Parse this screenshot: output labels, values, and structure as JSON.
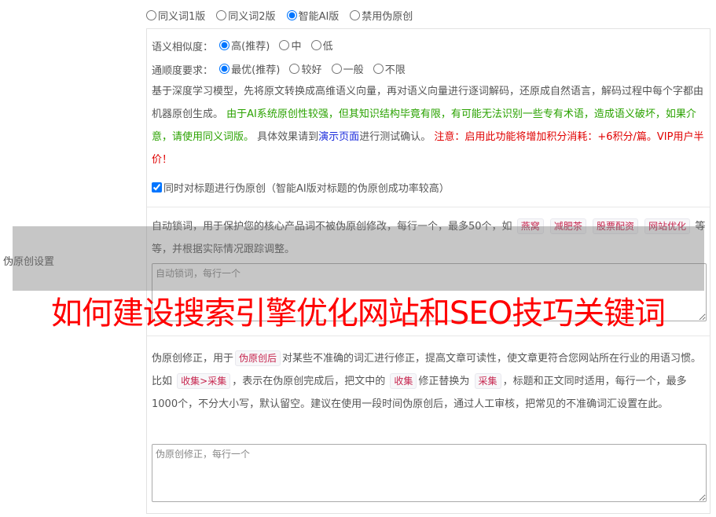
{
  "version_options": [
    {
      "label": "同义词1版",
      "checked": false
    },
    {
      "label": "同义词2版",
      "checked": false
    },
    {
      "label": "智能AI版",
      "checked": true
    },
    {
      "label": "禁用伪原创",
      "checked": false
    }
  ],
  "similarity": {
    "label": "语义相似度：",
    "options": [
      {
        "label": "高(推荐)",
        "checked": true
      },
      {
        "label": "中",
        "checked": false
      },
      {
        "label": "低",
        "checked": false
      }
    ]
  },
  "fluency": {
    "label": "通顺度要求：",
    "options": [
      {
        "label": "最优(推荐)",
        "checked": true
      },
      {
        "label": "较好",
        "checked": false
      },
      {
        "label": "一般",
        "checked": false
      },
      {
        "label": "不限",
        "checked": false
      }
    ]
  },
  "ai_desc": {
    "part1": "基于深度学习模型，先将原文转换成高维语义向量，再对语义向量进行逐词解码，还原成自然语言，解码过程中每个字都由机器原创生成。",
    "green": "由于AI系统原创性较强，但其知识结构毕竟有限，有可能无法识别一些专有术语，造成语义破坏，如果介意，请使用同义词版。",
    "part2": "具体效果请到",
    "link": "演示页面",
    "part3": "进行测试确认。",
    "red": "注意：启用此功能将增加积分消耗：+6积分/篇。VIP用户半价！"
  },
  "title_checkbox": {
    "label": "同时对标题进行伪原创（智能AI版对标题的伪原创成功率较高）",
    "checked": true
  },
  "lock": {
    "desc1": "自动锁词，用于保护您的核心产品词不被伪原创修改，每行一个，最多50个，如",
    "examples": [
      "燕窝",
      "减肥茶",
      "股票配资",
      "网站优化"
    ],
    "desc2": "等等，并根据实际情况跟踪调整。",
    "placeholder": "自动锁词，每行一个"
  },
  "correction": {
    "desc1": "伪原创修正，用于",
    "tag1": "伪原创后",
    "desc2": "对某些不准确的词汇进行修正，提高文章可读性，使文章更符合您网站所在行业的用语习惯。比如",
    "tag2": "收集>采集",
    "desc3": "，表示在伪原创完成后，把文中的",
    "tag3": "收集",
    "desc4": "修正替换为",
    "tag4": "采集",
    "desc5": "，标题和正文同时适用，每行一个，最多1000个，不分大小写，默认留空。建议在使用一段时间伪原创后，通过人工审核，把常见的不准确词汇设置在此。",
    "placeholder": "伪原创修正，每行一个"
  },
  "side_label": "伪原创设置",
  "watermark": "如何建设搜索引擎优化网站和SEO技巧关键词"
}
